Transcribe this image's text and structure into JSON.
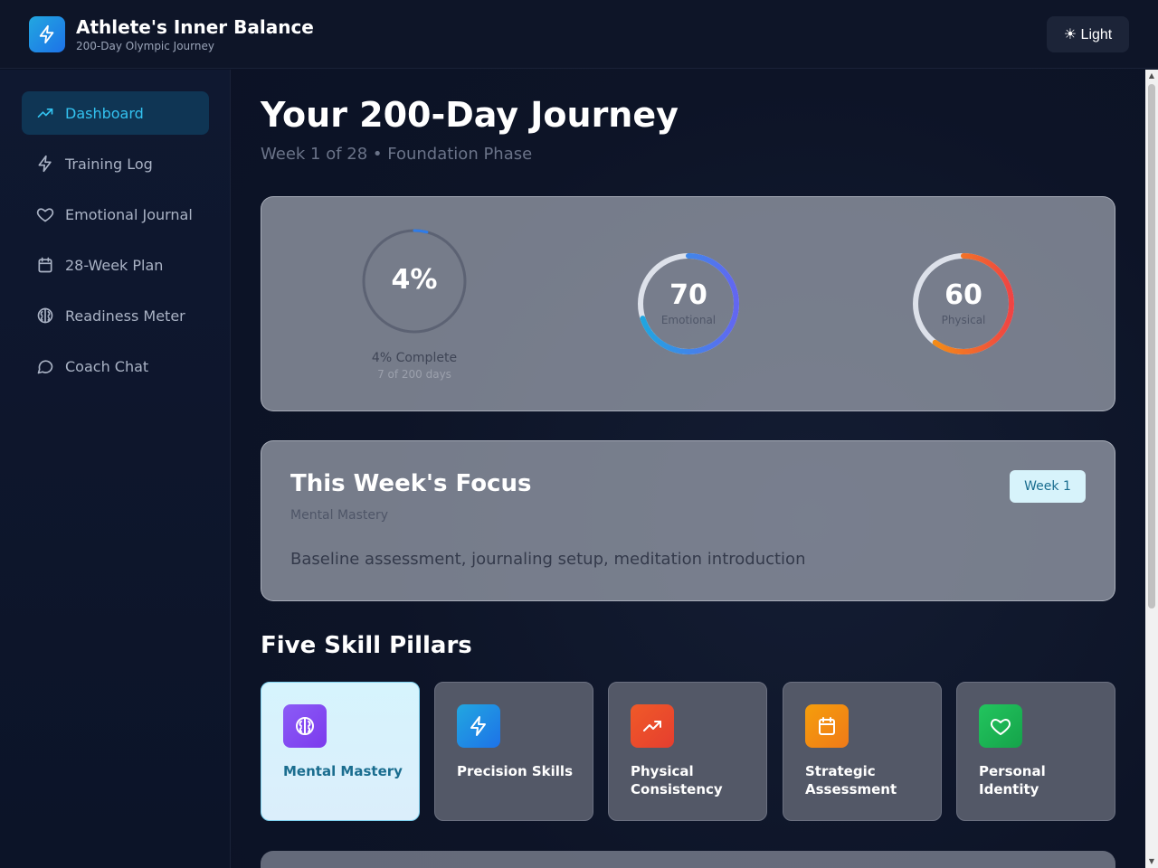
{
  "header": {
    "title": "Athlete's Inner Balance",
    "subtitle": "200-Day Olympic Journey",
    "theme_toggle": "☀ Light",
    "logo_icon": "lightning-icon"
  },
  "sidebar": {
    "items": [
      {
        "label": "Dashboard",
        "icon": "trending-up-icon",
        "active": true
      },
      {
        "label": "Training Log",
        "icon": "lightning-icon",
        "active": false
      },
      {
        "label": "Emotional Journal",
        "icon": "heart-icon",
        "active": false
      },
      {
        "label": "28-Week Plan",
        "icon": "calendar-icon",
        "active": false
      },
      {
        "label": "Readiness Meter",
        "icon": "brain-icon",
        "active": false
      },
      {
        "label": "Coach Chat",
        "icon": "chat-bubble-icon",
        "active": false
      }
    ]
  },
  "main": {
    "title": "Your 200-Day Journey",
    "subtitle": "Week 1 of 28 • Foundation Phase",
    "progress": {
      "percent_text": "4%",
      "percent": 4,
      "complete_label": "4% Complete",
      "days_label": "7 of 200 days"
    },
    "emotional": {
      "value": "70",
      "label": "Emotional",
      "percent": 70
    },
    "physical": {
      "value": "60",
      "label": "Physical",
      "percent": 60
    },
    "focus": {
      "title": "This Week's Focus",
      "subtitle": "Mental Mastery",
      "badge": "Week 1",
      "description": "Baseline assessment, journaling setup, meditation introduction"
    },
    "pillars_title": "Five Skill Pillars",
    "pillars": [
      {
        "label": "Mental Mastery",
        "icon": "brain-icon",
        "color": "#7c3aed"
      },
      {
        "label": "Precision Skills",
        "icon": "lightning-icon",
        "color": "#1d8fe8"
      },
      {
        "label": "Physical Consistency",
        "icon": "trending-up-icon",
        "color": "#ea4a2a"
      },
      {
        "label": "Strategic Assessment",
        "icon": "calendar-icon",
        "color": "#f08418"
      },
      {
        "label": "Personal Identity",
        "icon": "heart-icon",
        "color": "#16a34a"
      }
    ]
  },
  "colors": {
    "accent": "#33c2f0",
    "emotional_start": "#1ea7e0",
    "emotional_end": "#6366f1",
    "physical_start": "#f59e0b",
    "physical_end": "#ef4444"
  }
}
